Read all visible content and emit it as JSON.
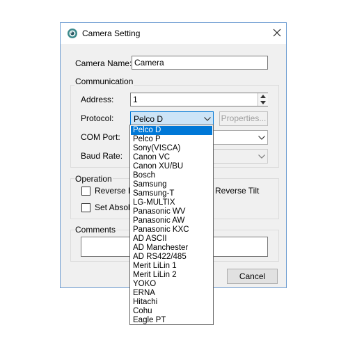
{
  "window": {
    "title": "Camera Setting",
    "icon": "camera-icon",
    "close_icon": "close-icon"
  },
  "camera_name": {
    "label": "Camera Name:",
    "value": "Camera"
  },
  "communication": {
    "group_label": "Communication",
    "address_label": "Address:",
    "address_value": "1",
    "protocol_label": "Protocol:",
    "protocol_value": "Pelco D",
    "properties_button": "Properties...",
    "com_port_label": "COM Port:",
    "baud_rate_label": "Baud Rate:"
  },
  "operation": {
    "group_label": "Operation",
    "reverse_pan_visible": "Reverse Pa",
    "reverse_tilt_visible": "Reverse Tilt",
    "set_absolute_visible": "Set Absolu"
  },
  "comments": {
    "group_label": "Comments",
    "value": ""
  },
  "buttons": {
    "cancel": "Cancel"
  },
  "protocol_dropdown": {
    "selected_index": 0,
    "options": [
      "Pelco D",
      "Pelco P",
      "Sony(VISCA)",
      "Canon VC",
      "Canon XU/BU",
      "Bosch",
      "Samsung",
      "Samsung-T",
      "LG-MULTIX",
      "Panasonic WV",
      "Panasonic AW",
      "Panasonic KXC",
      "AD ASCII",
      "AD Manchester",
      "AD RS422/485",
      "Merit LiLin 1",
      "Merit LiLin 2",
      "YOKO",
      "ERNA",
      "Hitachi",
      "Cohu",
      "Eagle PT"
    ]
  },
  "colors": {
    "selection": "#0078d7",
    "window_border": "#6b9bd1",
    "dialog_background": "#f0f0f0"
  }
}
